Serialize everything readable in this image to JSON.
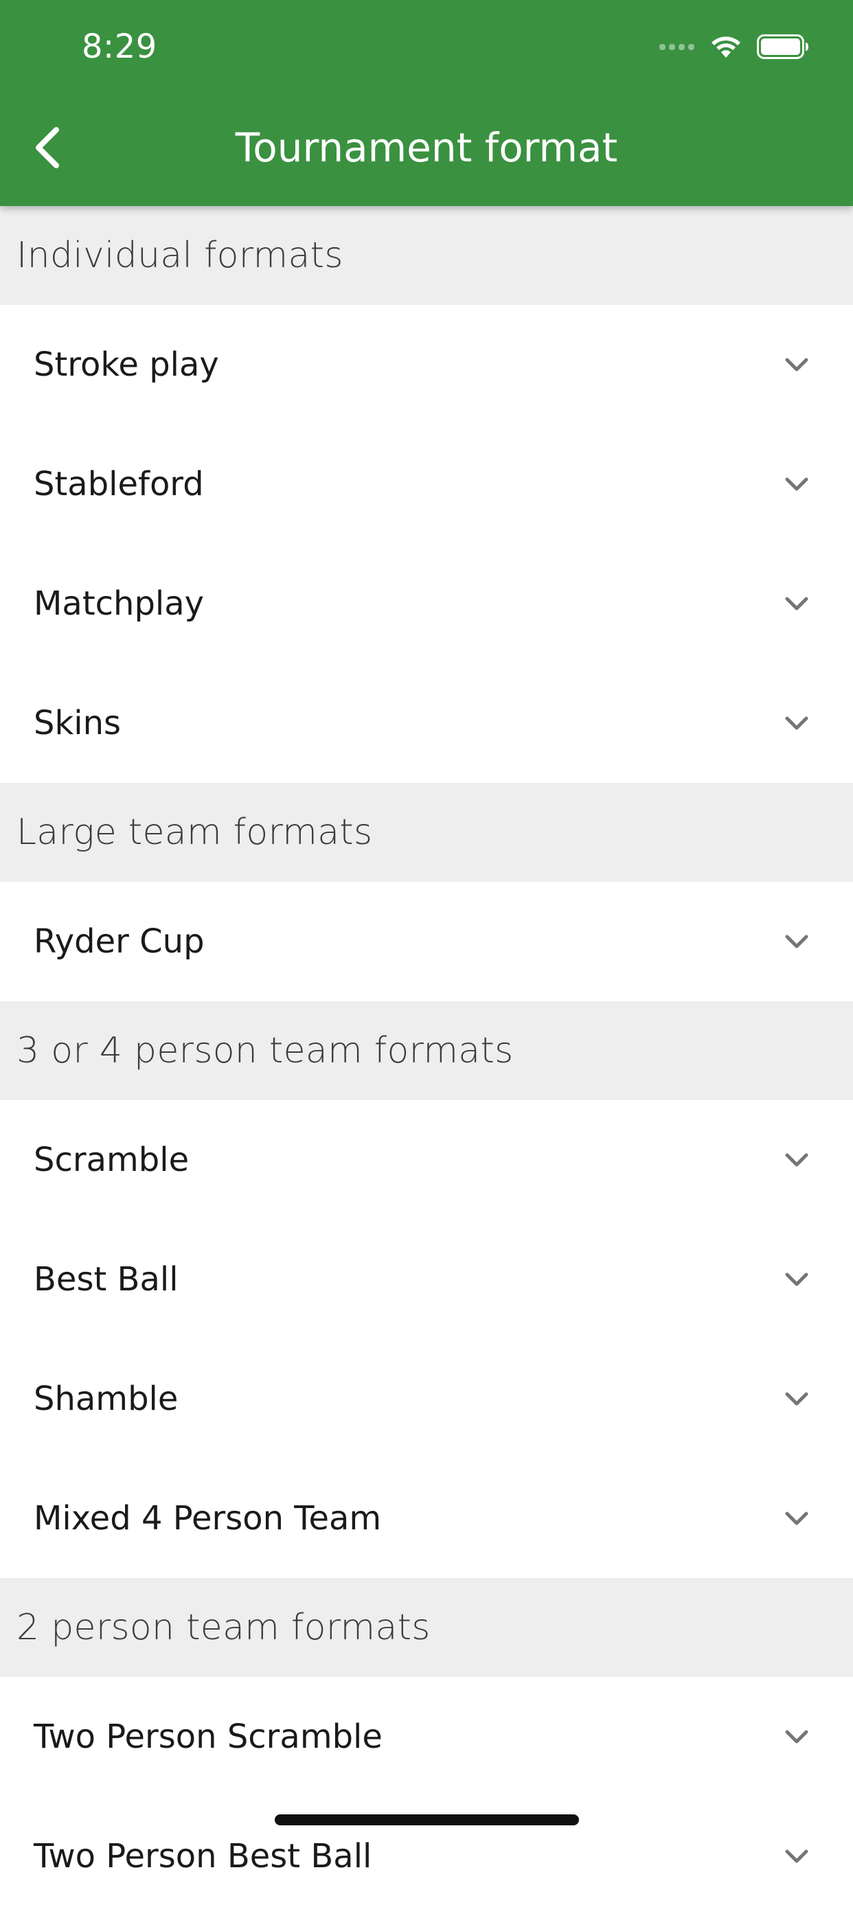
{
  "status_bar": {
    "time": "8:29"
  },
  "header": {
    "title": "Tournament format",
    "back_icon": "chevron-left-icon",
    "background": "#3a9140"
  },
  "sections": [
    {
      "title": "Individual formats",
      "items": [
        "Stroke play",
        "Stableford",
        "Matchplay",
        "Skins"
      ]
    },
    {
      "title": "Large team formats",
      "items": [
        "Ryder Cup"
      ]
    },
    {
      "title": "3 or 4 person team formats",
      "items": [
        "Scramble",
        "Best Ball",
        "Shamble",
        "Mixed 4 Person Team"
      ]
    },
    {
      "title": "2 person team formats",
      "items": [
        "Two Person Scramble",
        "Two Person Best Ball"
      ]
    }
  ],
  "item_icon": "chevron-down-icon"
}
